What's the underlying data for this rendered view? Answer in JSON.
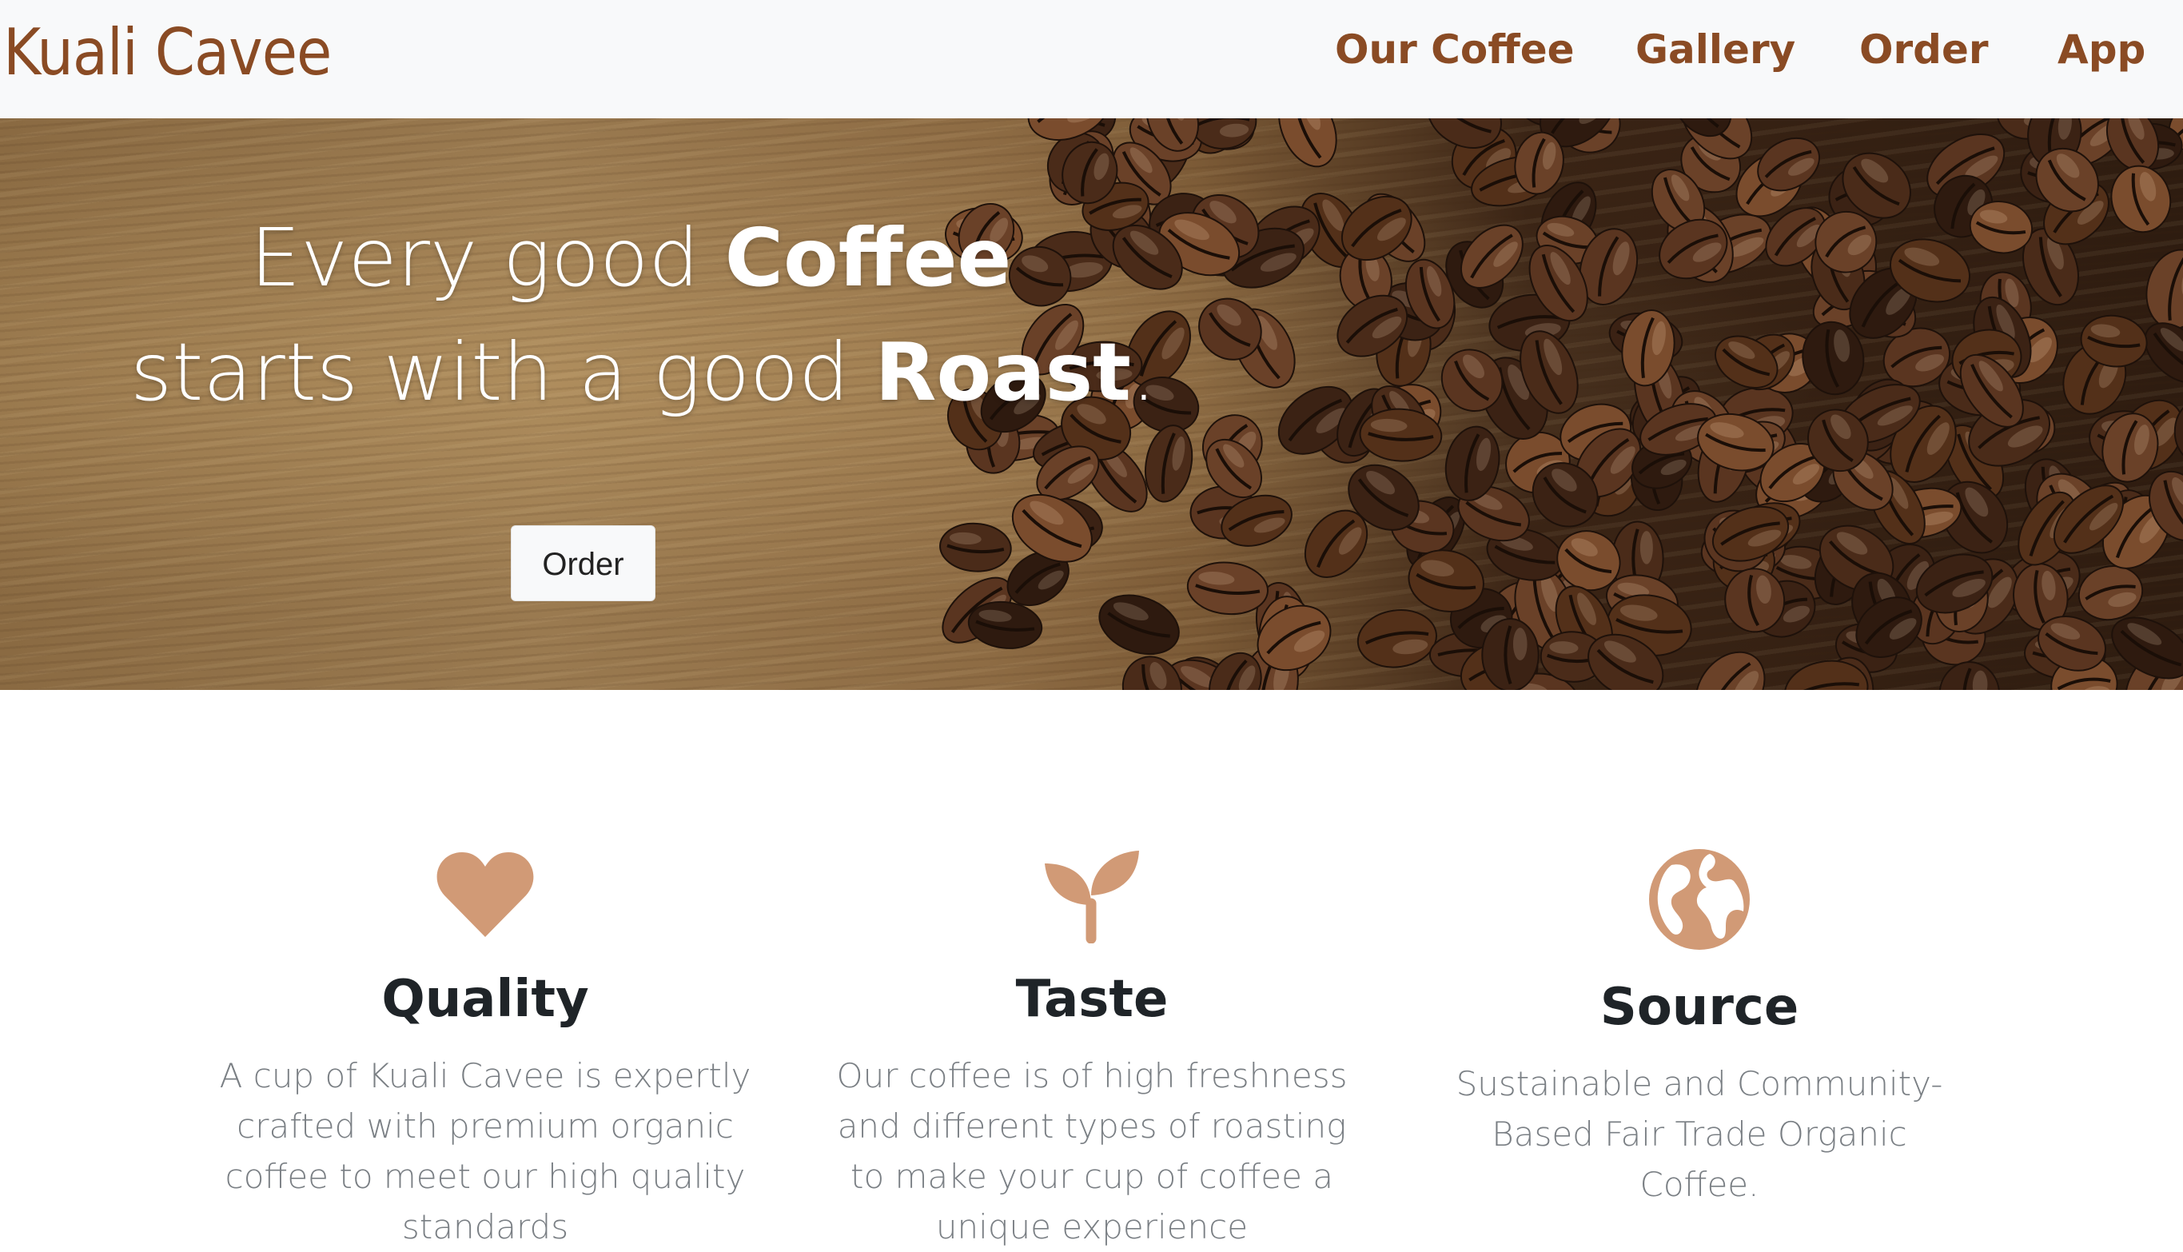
{
  "navbar": {
    "brand": "Kuali Cavee",
    "links": [
      "Our Coffee",
      "Gallery",
      "Order",
      "App"
    ]
  },
  "hero": {
    "line1_plain": "Every good ",
    "line1_bold": "Coffee",
    "line2_plain": "starts with a good ",
    "line2_bold": "Roast",
    "line2_end": ".",
    "button_label": "Order"
  },
  "features": [
    {
      "icon": "heart-icon",
      "title": "Quality",
      "text": "A cup of Kuali Cavee is expertly crafted with premium organic coffee to meet our high quality standards"
    },
    {
      "icon": "seedling-icon",
      "title": "Taste",
      "text": "Our coffee is of high freshness and different types of roasting to make your cup of coffee a unique experience"
    },
    {
      "icon": "globe-icon",
      "title": "Source",
      "text": "Sustainable and Community-Based Fair Trade Organic Coffee."
    }
  ],
  "colors": {
    "brand": "#8a4b24",
    "icon": "#d19a76",
    "heading": "#1f2428",
    "body_text": "#7a7f84",
    "navbar_bg": "#f8f9fa"
  }
}
